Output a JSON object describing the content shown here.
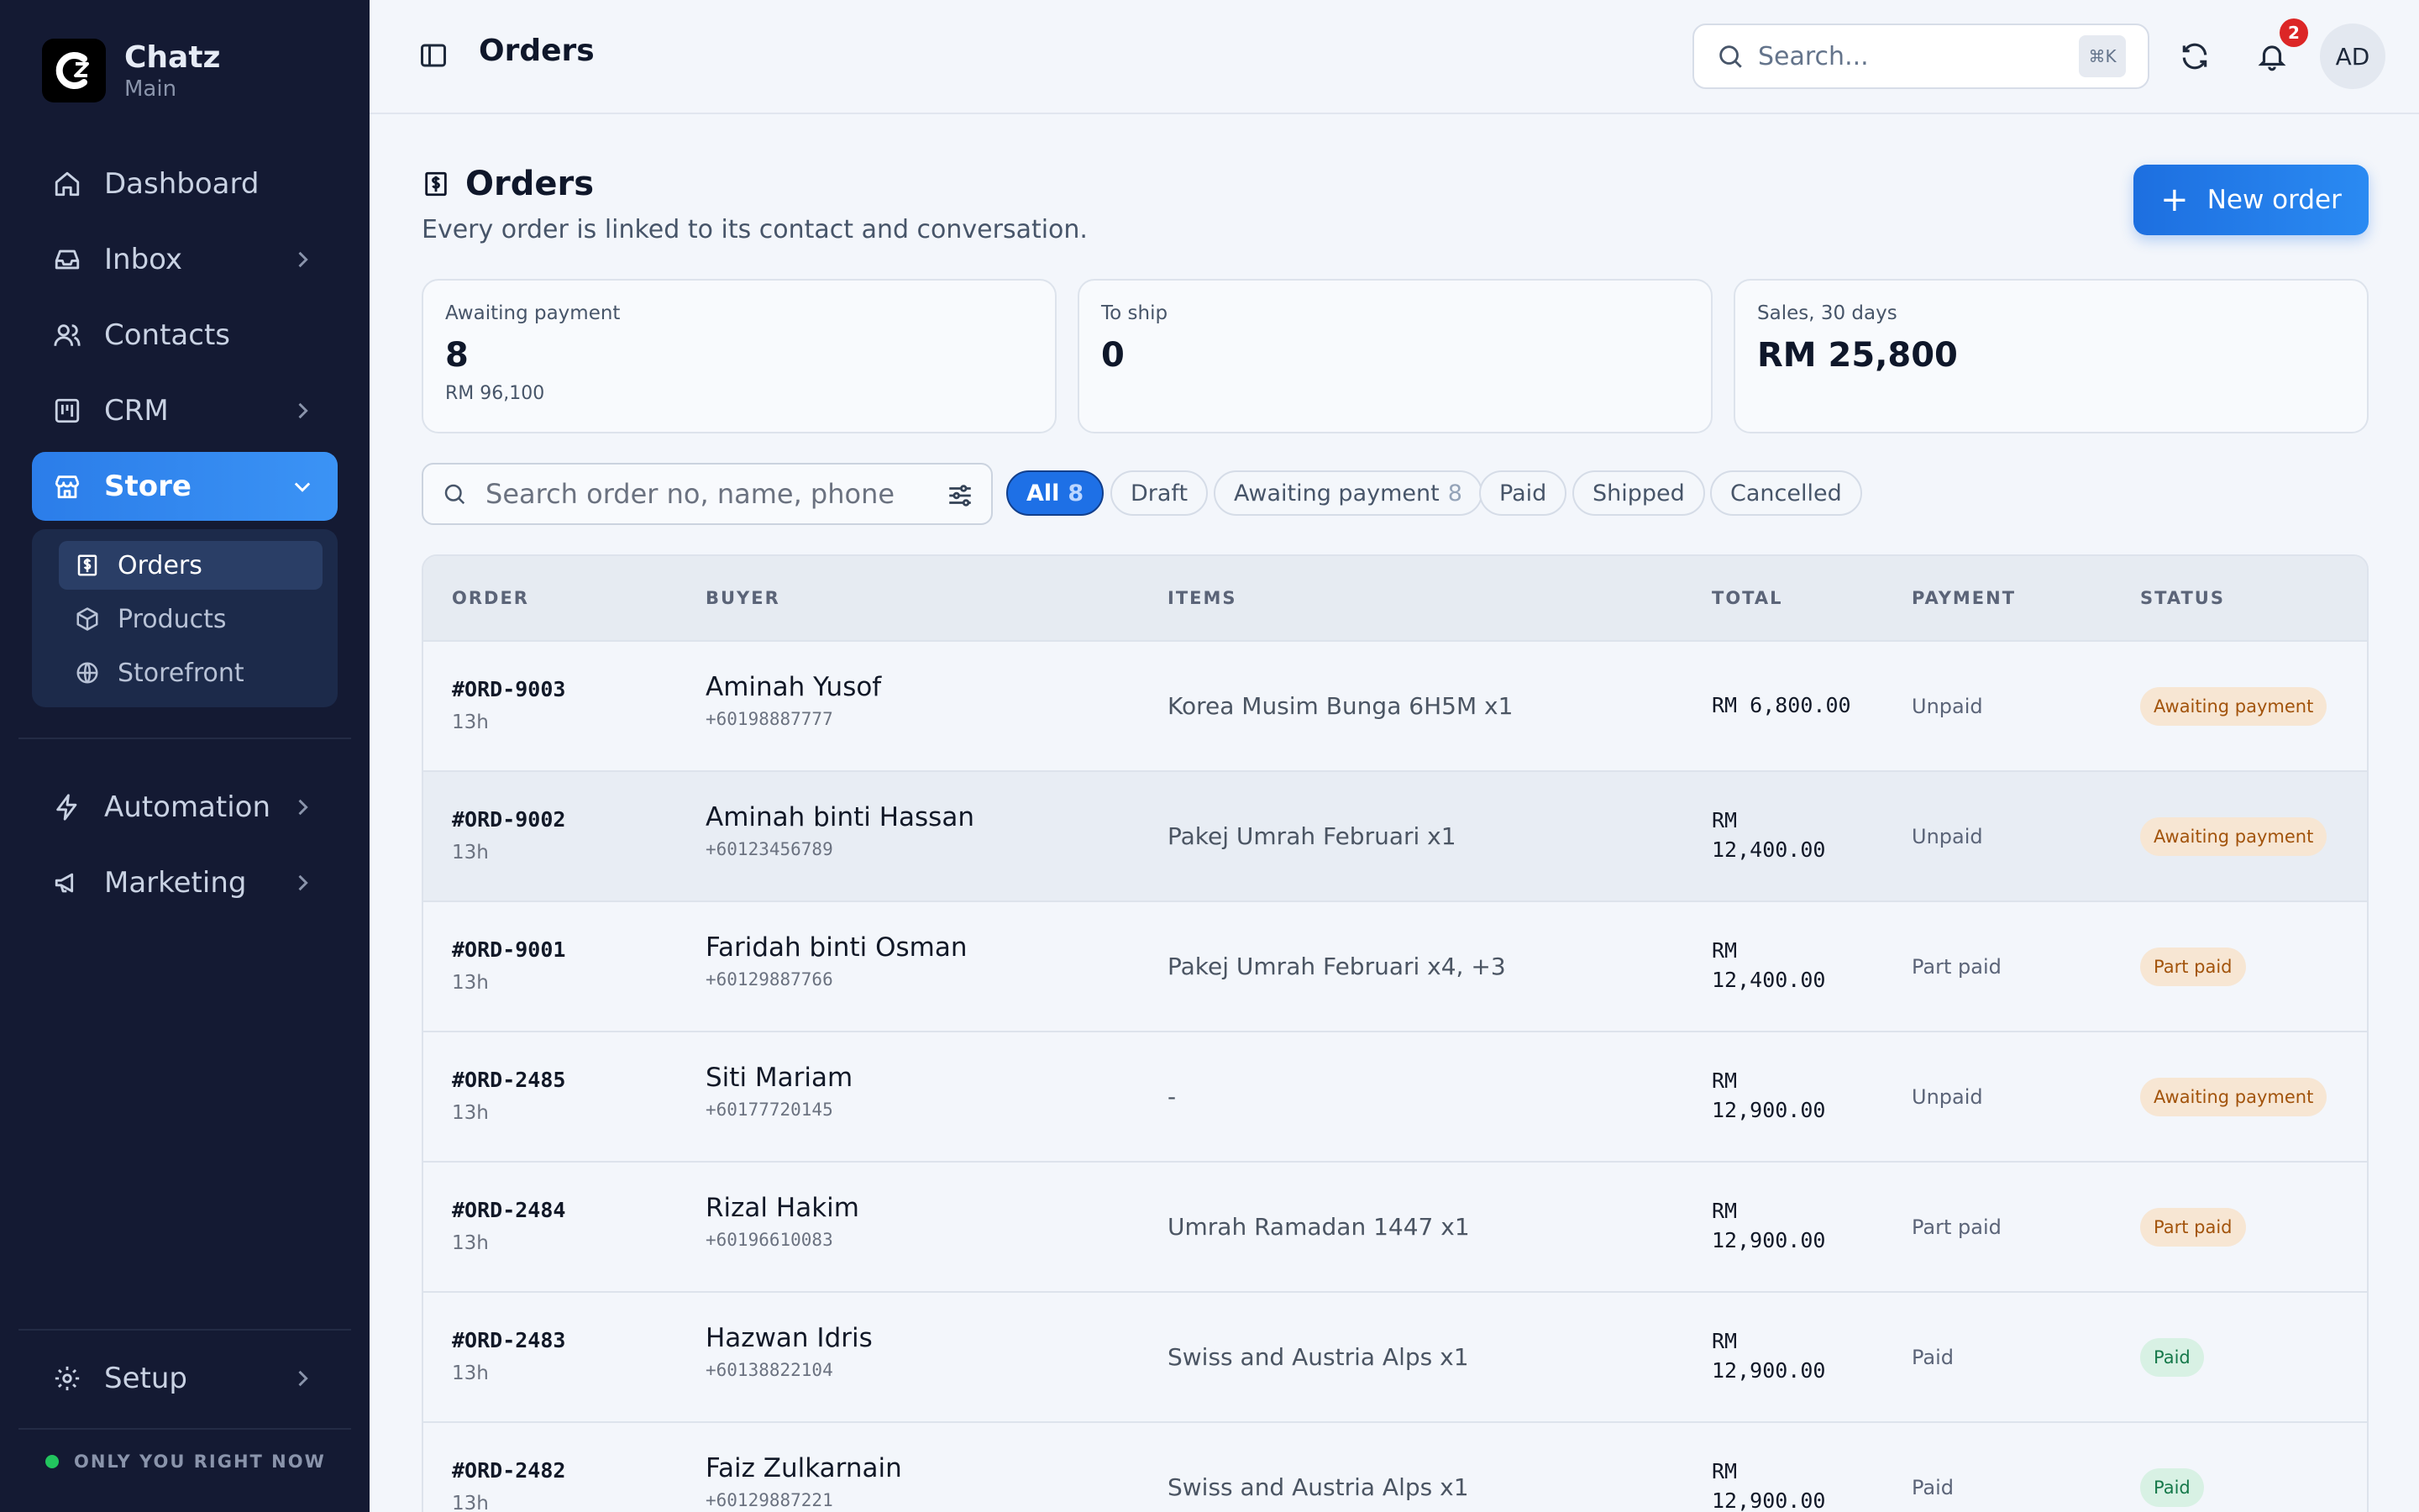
{
  "brand": {
    "name": "Chatz",
    "workspace": "Main"
  },
  "sidebar": {
    "items": [
      {
        "label": "Dashboard",
        "icon": "home-icon"
      },
      {
        "label": "Inbox",
        "icon": "inbox-icon"
      },
      {
        "label": "Contacts",
        "icon": "users-icon"
      },
      {
        "label": "CRM",
        "icon": "kanban-icon"
      },
      {
        "label": "Store",
        "icon": "store-icon"
      },
      {
        "label": "Automation",
        "icon": "bolt-icon"
      },
      {
        "label": "Marketing",
        "icon": "megaphone-icon"
      },
      {
        "label": "Setup",
        "icon": "gear-icon"
      }
    ],
    "store_sub": [
      {
        "label": "Orders",
        "icon": "receipt-icon"
      },
      {
        "label": "Products",
        "icon": "box-icon"
      },
      {
        "label": "Storefront",
        "icon": "globe-icon"
      }
    ],
    "presence": "ONLY YOU RIGHT NOW"
  },
  "topbar": {
    "title": "Orders",
    "search_placeholder": "Search...",
    "search_shortcut": "⌘K",
    "notification_count": "2",
    "avatar_initials": "AD"
  },
  "page": {
    "title": "Orders",
    "description": "Every order is linked to its contact and conversation.",
    "new_order_label": "New order"
  },
  "stats": [
    {
      "label": "Awaiting payment",
      "value": "8",
      "sub": "RM 96,100"
    },
    {
      "label": "To ship",
      "value": "0",
      "sub": ""
    },
    {
      "label": "Sales, 30 days",
      "value": "RM 25,800",
      "sub": ""
    }
  ],
  "filters": {
    "search_placeholder": "Search order no, name, phone",
    "chips": [
      {
        "label": "All",
        "count": "8"
      },
      {
        "label": "Draft",
        "count": ""
      },
      {
        "label": "Awaiting payment",
        "count": "8"
      },
      {
        "label": "Paid",
        "count": ""
      },
      {
        "label": "Shipped",
        "count": ""
      },
      {
        "label": "Cancelled",
        "count": ""
      }
    ]
  },
  "table": {
    "columns": [
      "ORDER",
      "BUYER",
      "ITEMS",
      "TOTAL",
      "PAYMENT",
      "STATUS"
    ],
    "rows": [
      {
        "order": "#ORD-9003",
        "age": "13h",
        "buyer": "Aminah Yusof",
        "phone": "+60198887777",
        "items": "Korea Musim Bunga 6H5M x1",
        "total_l1": "RM 6,800.00",
        "total_l2": "",
        "payment": "Unpaid",
        "status": "Awaiting payment"
      },
      {
        "order": "#ORD-9002",
        "age": "13h",
        "buyer": "Aminah binti Hassan",
        "phone": "+60123456789",
        "items": "Pakej Umrah Februari x1",
        "total_l1": "RM",
        "total_l2": "12,400.00",
        "payment": "Unpaid",
        "status": "Awaiting payment"
      },
      {
        "order": "#ORD-9001",
        "age": "13h",
        "buyer": "Faridah binti Osman",
        "phone": "+60129887766",
        "items": "Pakej Umrah Februari x4, +3",
        "total_l1": "RM",
        "total_l2": "12,400.00",
        "payment": "Part paid",
        "status": "Part paid"
      },
      {
        "order": "#ORD-2485",
        "age": "13h",
        "buyer": "Siti Mariam",
        "phone": "+60177720145",
        "items": "-",
        "total_l1": "RM",
        "total_l2": "12,900.00",
        "payment": "Unpaid",
        "status": "Awaiting payment"
      },
      {
        "order": "#ORD-2484",
        "age": "13h",
        "buyer": "Rizal Hakim",
        "phone": "+60196610083",
        "items": "Umrah Ramadan 1447 x1",
        "total_l1": "RM",
        "total_l2": "12,900.00",
        "payment": "Part paid",
        "status": "Part paid"
      },
      {
        "order": "#ORD-2483",
        "age": "13h",
        "buyer": "Hazwan Idris",
        "phone": "+60138822104",
        "items": "Swiss and Austria Alps x1",
        "total_l1": "RM",
        "total_l2": "12,900.00",
        "payment": "Paid",
        "status": "Paid"
      },
      {
        "order": "#ORD-2482",
        "age": "13h",
        "buyer": "Faiz Zulkarnain",
        "phone": "+60129887221",
        "items": "Swiss and Austria Alps x1",
        "total_l1": "RM",
        "total_l2": "12,900.00",
        "payment": "Paid",
        "status": "Paid"
      }
    ]
  },
  "colors": {
    "accent": "#2b7de9",
    "sidebar_bg": "#141a33",
    "badge_warn": "#a2530b",
    "badge_ok": "#16794a",
    "notif": "#dc2626"
  }
}
